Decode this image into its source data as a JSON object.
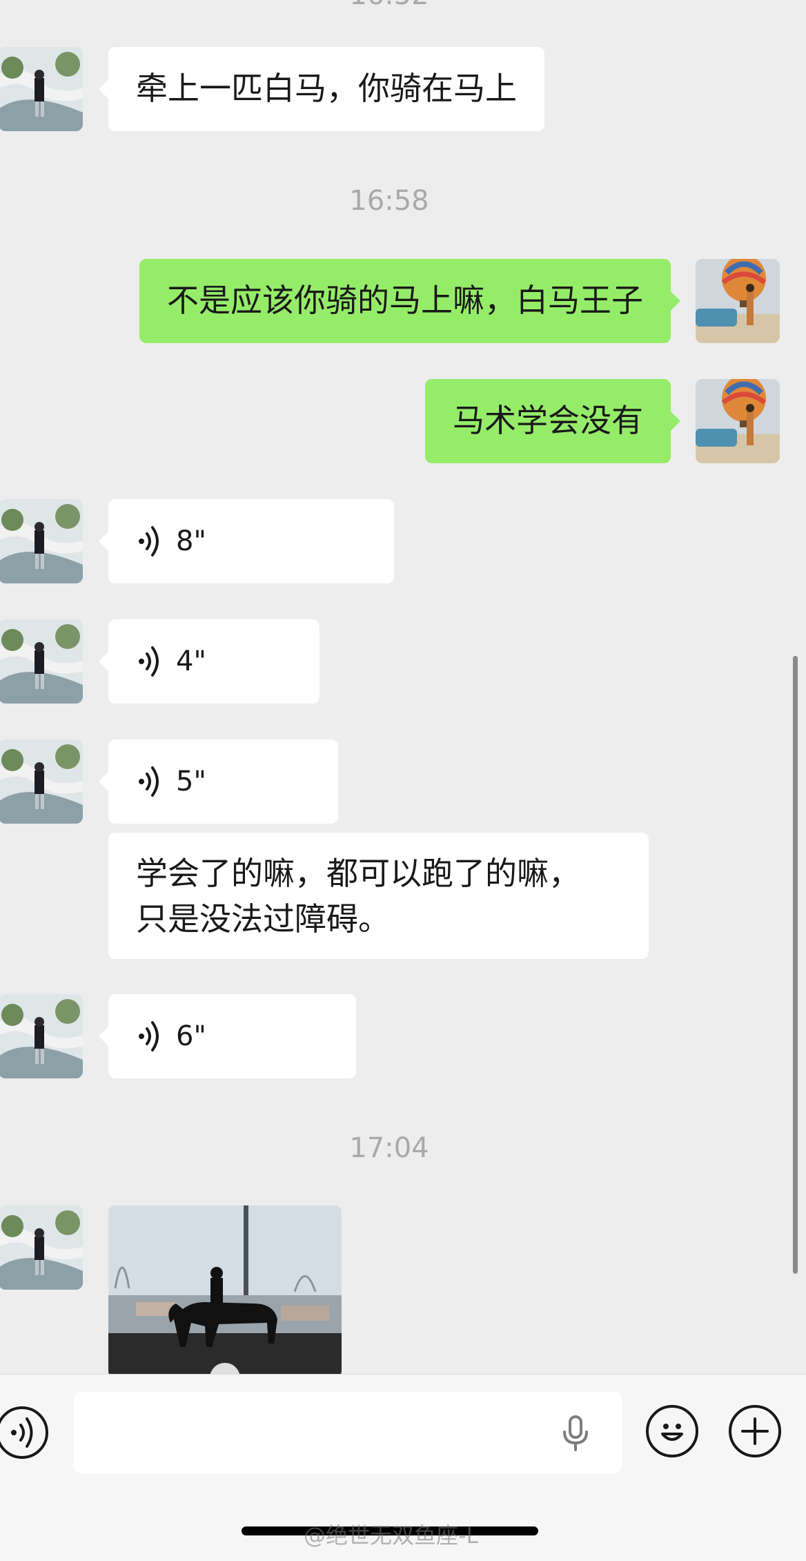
{
  "messages": [
    {
      "type": "text",
      "side": "in",
      "text": "牵上一匹白马，你骑在马上"
    },
    {
      "type": "time",
      "text": "16:58"
    },
    {
      "type": "text",
      "side": "out",
      "text": "不是应该你骑的马上嘛，白马王子"
    },
    {
      "type": "text",
      "side": "out",
      "text": "马术学会没有"
    },
    {
      "type": "voice",
      "side": "in",
      "duration": "8\""
    },
    {
      "type": "voice",
      "side": "in",
      "duration": "4\""
    },
    {
      "type": "voice",
      "side": "in",
      "duration": "5\""
    },
    {
      "type": "text",
      "side": "in",
      "line1": "学会了的嘛，都可以跑了的嘛，",
      "line2": "只是没法过障碍。"
    },
    {
      "type": "voice",
      "side": "in",
      "duration": "6\""
    },
    {
      "type": "time",
      "text": "17:04"
    },
    {
      "type": "video",
      "side": "in"
    }
  ],
  "input": {
    "placeholder": ""
  },
  "watermark": "@绝世无双鱼座-L",
  "colors": {
    "background": "#ededed",
    "incoming_bubble": "#ffffff",
    "outgoing_bubble": "#95ec69",
    "timestamp": "#a9a9a9"
  },
  "icons": {
    "voice_toggle": "voice-mode-icon",
    "mic": "microphone-icon",
    "emoji": "emoji-icon",
    "more": "plus-icon",
    "voice_message": "voice-wave-icon"
  }
}
